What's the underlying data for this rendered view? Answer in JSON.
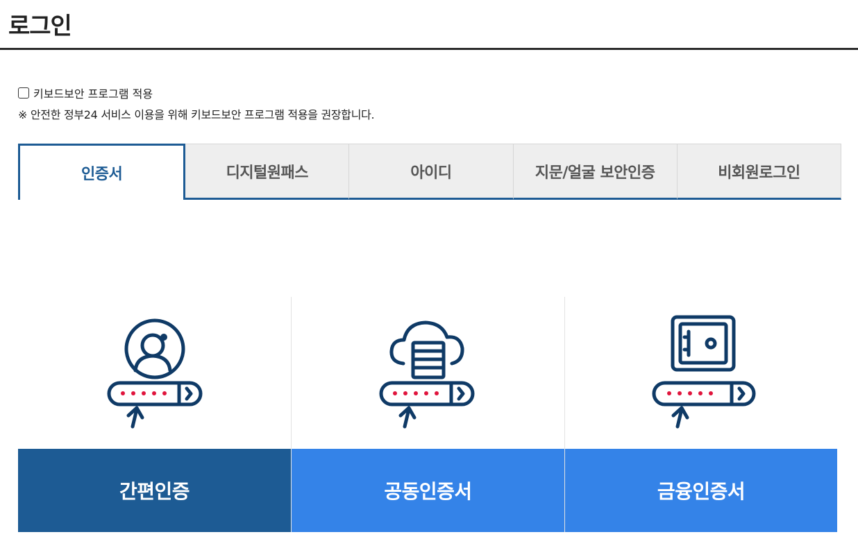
{
  "header": {
    "title": "로그인"
  },
  "keyboard_security": {
    "checkbox_label": "키보드보안 프로그램 적용",
    "checked": false,
    "notice": "※ 안전한 정부24 서비스 이용을 위해 키보드보안 프로그램 적용을 권장합니다."
  },
  "tabs": [
    {
      "label": "인증서",
      "active": true
    },
    {
      "label": "디지털원패스",
      "active": false
    },
    {
      "label": "아이디",
      "active": false
    },
    {
      "label": "지문/얼굴 보안인증",
      "active": false
    },
    {
      "label": "비회원로그인",
      "active": false
    }
  ],
  "cards": [
    {
      "label": "간편인증",
      "icon": "user-password-icon"
    },
    {
      "label": "공동인증서",
      "icon": "cloud-database-password-icon"
    },
    {
      "label": "금융인증서",
      "icon": "safe-password-icon"
    }
  ],
  "colors": {
    "primary_dark": "#1d5b94",
    "primary_light": "#3483e8",
    "icon_navy": "#0f3a66",
    "password_dot": "#e0143c"
  }
}
